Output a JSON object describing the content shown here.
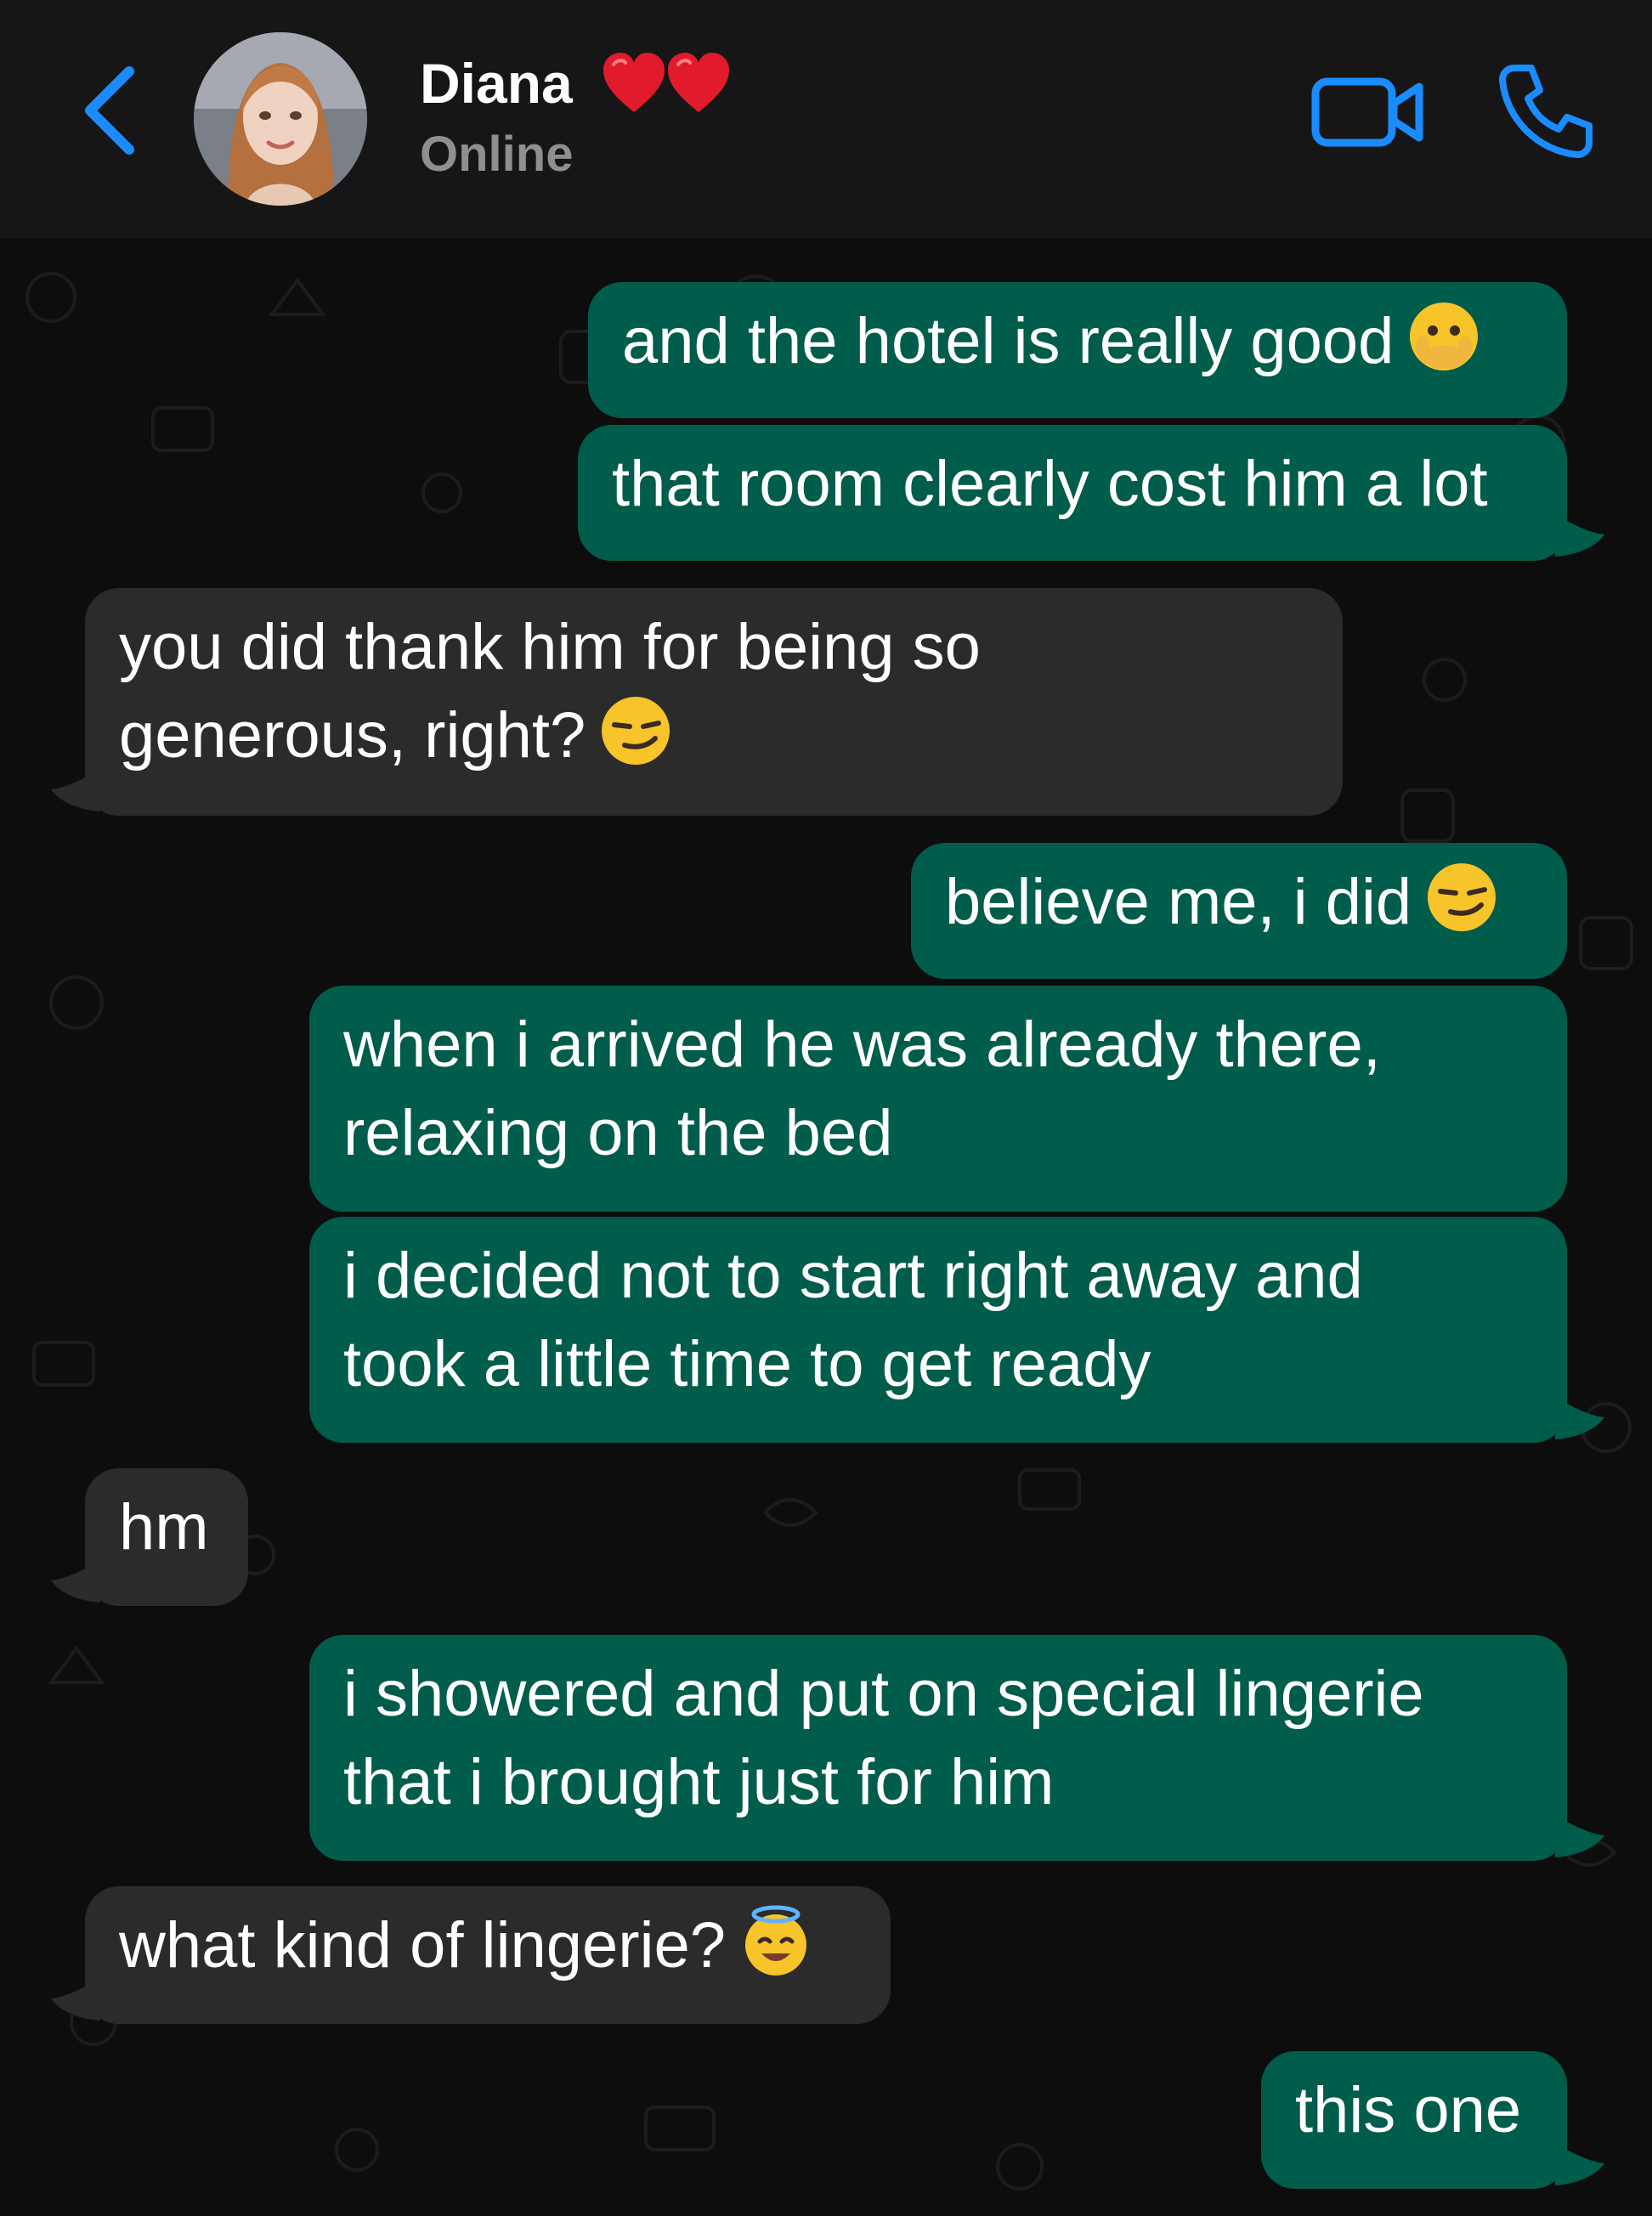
{
  "header": {
    "contact_name": "Diana",
    "name_suffix_icons": [
      "red-heart-icon",
      "red-heart-icon"
    ],
    "status": "Online",
    "back_icon": "chevron-left-icon",
    "video_icon": "video-camera-icon",
    "call_icon": "phone-icon",
    "accent_color": "#1a8cff"
  },
  "messages": [
    {
      "direction": "outgoing",
      "text": "and the hotel is really good",
      "emoji": "face-with-open-eyes-and-hand-over-mouth"
    },
    {
      "direction": "outgoing",
      "text": "that room clearly cost him a lot"
    },
    {
      "direction": "incoming",
      "lines": [
        "you did thank him for being so",
        "generous, right?"
      ],
      "emoji": "smirking-face"
    },
    {
      "direction": "outgoing",
      "text": "believe me, i did",
      "emoji": "smirking-face"
    },
    {
      "direction": "outgoing",
      "lines": [
        "when i arrived he was already there,",
        "relaxing on the bed"
      ]
    },
    {
      "direction": "outgoing",
      "lines": [
        "i decided not to start right away and",
        "took a little time to get ready"
      ]
    },
    {
      "direction": "incoming",
      "text": "hm"
    },
    {
      "direction": "outgoing",
      "lines": [
        "i showered and put on special lingerie",
        "that i brought just for him"
      ]
    },
    {
      "direction": "incoming",
      "text": "what kind of lingerie?",
      "emoji": "smiling-face-with-halo"
    },
    {
      "direction": "outgoing",
      "text": "this one"
    }
  ],
  "colors": {
    "outgoing_bubble": "#005c4b",
    "incoming_bubble": "#2b2b2b",
    "header_background": "#161616",
    "chat_background": "#0d0d0d"
  }
}
